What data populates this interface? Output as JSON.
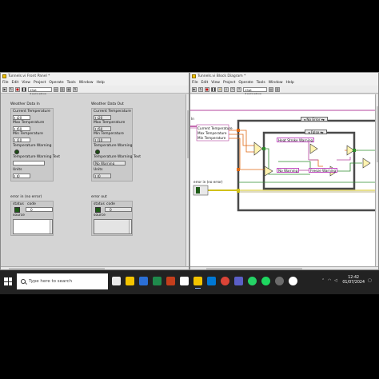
{
  "front_panel": {
    "title": "Tunnels.vi Front Panel *",
    "menu": [
      "File",
      "Edit",
      "View",
      "Project",
      "Operate",
      "Tools",
      "Window",
      "Help"
    ],
    "font": "15pt Application Font",
    "weather_in": {
      "label": "Weather Data In",
      "current_temp_label": "Current Temperature",
      "current_temp": "20",
      "max_temp_label": "Max Temperature",
      "max_temp": "50",
      "min_temp_label": "Min Temperature",
      "min_temp": "10",
      "warning_label": "Temperature Warning",
      "warning_text_label": "Temperature Warning Text",
      "warning_text": "",
      "units_label": "Units",
      "units": "0"
    },
    "weather_out": {
      "label": "Weather Data Out",
      "current_temp_label": "Current Temperature",
      "current_temp": "20",
      "max_temp_label": "Max Temperature",
      "max_temp": "50",
      "min_temp_label": "Min Temperature",
      "min_temp": "10",
      "warning_label": "Temperature Warning",
      "warning_text_label": "Temperature Warning Text",
      "warning_text": "No Warning",
      "units_label": "Units",
      "units": "0"
    },
    "error_in": {
      "label": "error in (no error)",
      "status_label": "status",
      "code_label": "code",
      "code": "0",
      "source_label": "source"
    },
    "error_out": {
      "label": "error out",
      "status_label": "status",
      "code_label": "code",
      "code": "0",
      "source_label": "source"
    }
  },
  "block_diagram": {
    "title": "Tunnels.vi Block Diagram *",
    "menu": [
      "File",
      "Edit",
      "View",
      "Project",
      "Operate",
      "Tools",
      "Window",
      "Help"
    ],
    "font": "15pt Application Font",
    "cluster_in_label": "In",
    "unbundle": [
      "Current Temperature",
      "Max Temperature",
      "Min Temperature"
    ],
    "error_selector": "No Error",
    "inner_selector": "False",
    "heat_warning": "Heat Stroke Warning",
    "no_warning": "No Warning",
    "freeze_warning": "Freeze Warning",
    "error_in_label": "error in (no error)"
  },
  "taskbar": {
    "search_placeholder": "Type here to search",
    "time": "12:42",
    "date": "01/07/2024"
  },
  "colors": {
    "cluster_wire": "#b5459d",
    "bool_wire": "#2e8b2e",
    "numeric_wire": "#e06a14",
    "error_wire": "#d1c11a",
    "case_border": "#4a4a4a"
  }
}
